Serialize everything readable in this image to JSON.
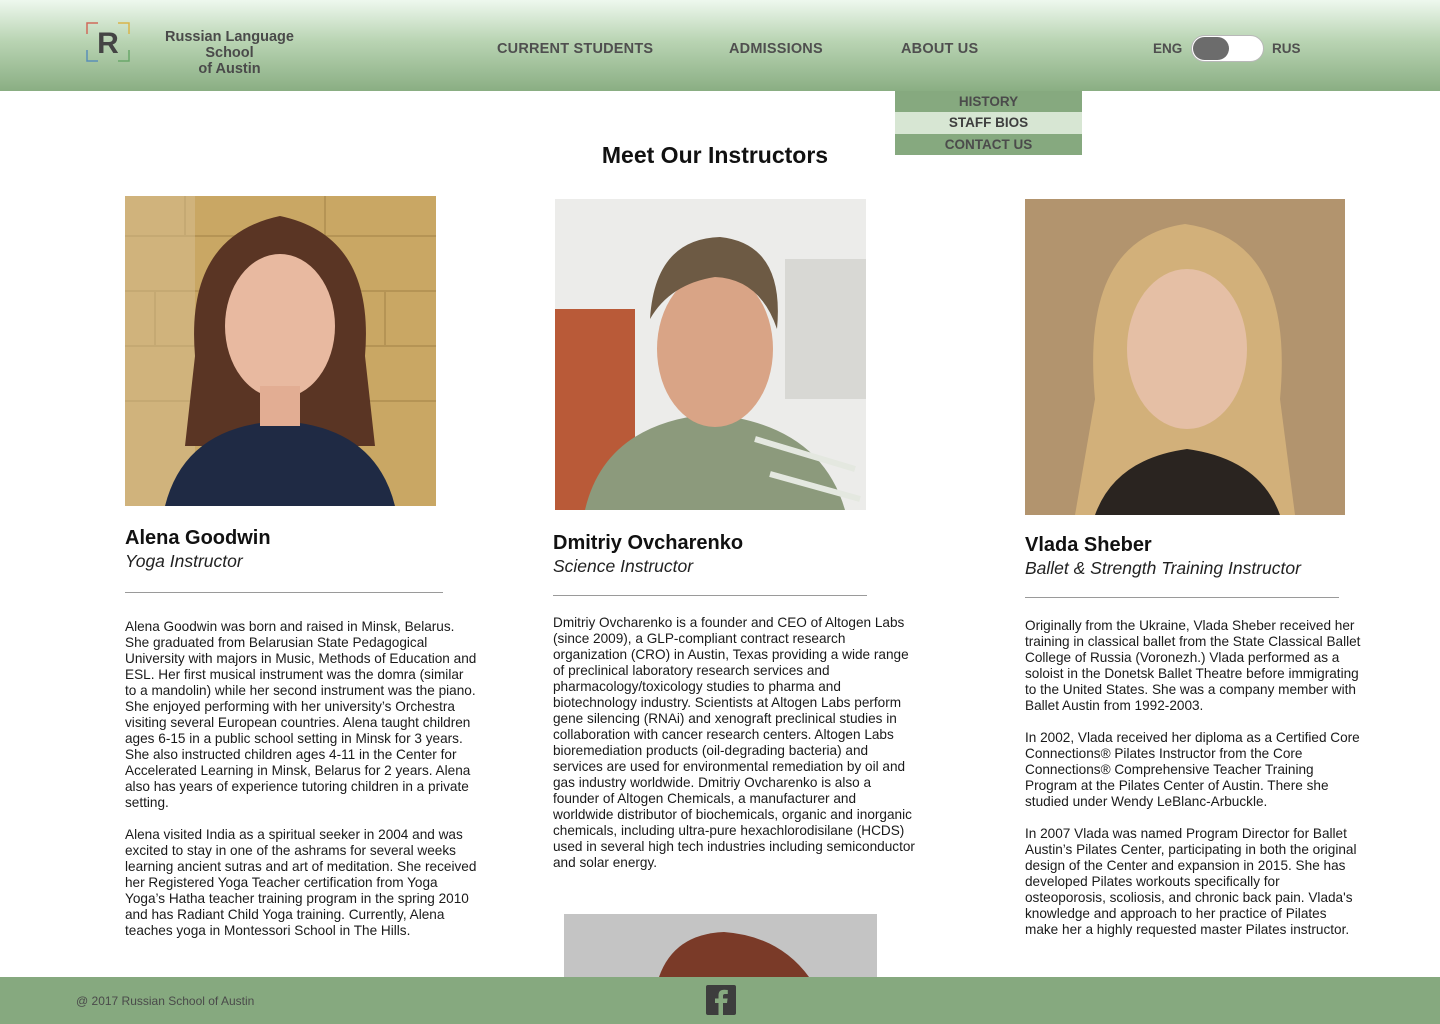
{
  "header": {
    "logo_letter": "R",
    "school_name_line1": "Russian Language School",
    "school_name_line2": "of Austin",
    "nav": [
      {
        "label": "CURRENT STUDENTS"
      },
      {
        "label": "ADMISSIONS"
      },
      {
        "label": "ABOUT US"
      }
    ],
    "lang_left": "ENG",
    "lang_right": "RUS",
    "lang_selected": "ENG"
  },
  "dropdown": {
    "items": [
      {
        "label": "HISTORY"
      },
      {
        "label": "STAFF BIOS"
      },
      {
        "label": "CONTACT US"
      }
    ],
    "active": "STAFF BIOS"
  },
  "page": {
    "title": "Meet Our Instructors"
  },
  "instructors": [
    {
      "name": "Alena Goodwin",
      "role": "Yoga Instructor",
      "bio": [
        "Alena Goodwin was born and raised in Minsk, Belarus. She graduated from Belarusian State Pedagogical University with majors in Music, Methods of Education and ESL. Her first musical instrument was the domra (similar to a mandolin) while her second instrument was the piano. She enjoyed performing with her university’s Orchestra visiting several European countries. Alena taught children ages 6-15 in a public school setting in Minsk for 3 years. She also instructed children ages 4-11 in the Center for Accelerated Learning in Minsk, Belarus for 2 years. Alena also has years of experience tutoring children in a private setting.",
        "Alena visited India as a spiritual seeker in 2004 and was excited to stay in one of the ashrams for several weeks learning ancient sutras and art of meditation. She received her Registered Yoga Teacher certification from Yoga Yoga’s Hatha teacher training program in the spring 2010 and has Radiant Child Yoga training. Currently, Alena teaches yoga in Montessori School in The Hills."
      ]
    },
    {
      "name": "Dmitriy Ovcharenko",
      "role": "Science Instructor",
      "bio": [
        "Dmitriy Ovcharenko is a founder and CEO of Altogen Labs (since 2009), a GLP-compliant contract research organization (CRO) in Austin, Texas providing a wide range of preclinical laboratory research services and pharmacology/toxicology studies to pharma and biotechnology industry. Scientists at Altogen Labs perform gene silencing (RNAi) and xenograft preclinical studies in collaboration with cancer research centers. Altogen Labs bioremediation products (oil-degrading bacteria) and services are used for environmental remediation by oil and gas industry worldwide. Dmitriy Ovcharenko is also a founder of Altogen Chemicals, a manufacturer and worldwide distributor of biochemicals, organic and inorganic chemicals, including ultra-pure hexachlorodisilane (HCDS) used in several high tech industries including semiconductor and solar energy."
      ]
    },
    {
      "name": "Vlada Sheber",
      "role": "Ballet & Strength Training Instructor",
      "bio": [
        "Originally from the Ukraine, Vlada Sheber received her training in classical ballet from the State Classical Ballet College of Russia (Voronezh.) Vlada performed as a soloist in the Donetsk Ballet Theatre before immigrating to the United States. She was a company member with Ballet Austin from 1992-2003.",
        "In 2002, Vlada received her diploma as a Certified Core Connections® Pilates Instructor from the Core Connections® Comprehensive Teacher Training Program at the Pilates Center of Austin. There she studied under Wendy LeBlanc-Arbuckle.",
        "In 2007 Vlada was named Program Director for Ballet Austin’s Pilates Center, participating in both the original design of the Center and expansion in 2015. She has developed Pilates workouts specifically for osteoporosis, scoliosis, and chronic back pain. Vlada's knowledge and approach to her practice of Pilates make her a highly requested master Pilates instructor."
      ]
    }
  ],
  "footer": {
    "copyright": "@ 2017 Russian School of Austin",
    "social_icon": "facebook-icon"
  },
  "colors": {
    "header_green": "#8aae83",
    "footer_green": "#86a97f",
    "dropdown_active": "#d7e6d3"
  }
}
